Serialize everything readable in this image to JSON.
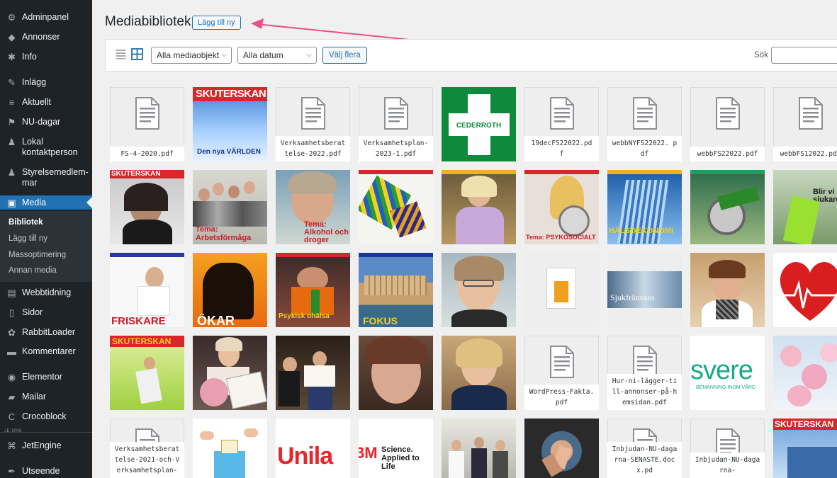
{
  "sidebar": {
    "items": [
      {
        "label": "Adminpanel",
        "icon": "dashboard-icon",
        "glyph": "⚙"
      },
      {
        "label": "Annonser",
        "icon": "pin-icon",
        "glyph": "◆"
      },
      {
        "label": "Info",
        "icon": "gear-icon",
        "glyph": "✱"
      },
      {
        "label": "Inlägg",
        "icon": "pushpin-icon",
        "glyph": "✎"
      },
      {
        "label": "Aktuellt",
        "icon": "menu-icon",
        "glyph": "≡"
      },
      {
        "label": "NU-dagar",
        "icon": "flag-icon",
        "glyph": "⚑"
      },
      {
        "label": "Lokal kontaktperson",
        "icon": "person-icon",
        "glyph": "♟"
      },
      {
        "label": "Styrelsemedlem-mar",
        "icon": "person-icon",
        "glyph": "♟"
      },
      {
        "label": "Media",
        "icon": "media-icon",
        "glyph": "▣"
      },
      {
        "label": "Webbtidning",
        "icon": "table-icon",
        "glyph": "▤"
      },
      {
        "label": "Sidor",
        "icon": "page-icon",
        "glyph": "▯"
      },
      {
        "label": "RabbitLoader",
        "icon": "rabbit-icon",
        "glyph": "✿"
      },
      {
        "label": "Kommentarer",
        "icon": "comment-icon",
        "glyph": "▬"
      },
      {
        "label": "Elementor",
        "icon": "elementor-icon",
        "glyph": "◉"
      },
      {
        "label": "Mailar",
        "icon": "folder-icon",
        "glyph": "▰"
      },
      {
        "label": "Crocoblock",
        "icon": "crocoblock-icon",
        "glyph": "C"
      },
      {
        "label": "JetEngine",
        "icon": "jetengine-icon",
        "glyph": "⌘"
      },
      {
        "label": "Utseende",
        "icon": "brush-icon",
        "glyph": "✒"
      }
    ],
    "submenu": [
      "Bibliotek",
      "Lägg till ny",
      "Massoptimering",
      "Annan media"
    ],
    "jet_divider": "JE·ONS"
  },
  "header": {
    "title": "Mediabibliotek",
    "add_new": "Lägg till ny"
  },
  "toolbar": {
    "filter_type": "Alla mediaobjekt",
    "filter_date": "Alla datum",
    "bulk_select": "Välj flera",
    "search_label": "Sök",
    "search_value": ""
  },
  "colors": {
    "sidebar_bg": "#1d2327",
    "active_bg": "#2271b1",
    "annotation_arrow": "#e8518a"
  },
  "media": [
    {
      "kind": "doc",
      "label": "FS-4-2020.pdf"
    },
    {
      "kind": "img",
      "style": "skuterskan-blue",
      "text": "SKUTERSKAN",
      "text2": "Den nya VÄRLDEN"
    },
    {
      "kind": "doc",
      "label": "Verksamhetsberat telse-2022.pdf"
    },
    {
      "kind": "doc",
      "label": "Verksamhetsplan-2023-1.pdf"
    },
    {
      "kind": "img",
      "style": "cederroth",
      "text": "CEDERROTH"
    },
    {
      "kind": "doc",
      "label": "19decFS22022.pd f"
    },
    {
      "kind": "doc",
      "label": "webbNYFS22022. pdf"
    },
    {
      "kind": "doc",
      "label": "webbFS22022.pdf"
    },
    {
      "kind": "doc",
      "label": "webbFS12022.pdf"
    },
    {
      "kind": "img",
      "style": "cover-portrait-dark",
      "text": "SKUTERSKAN"
    },
    {
      "kind": "img",
      "style": "cover-group",
      "text": "Tema: Arbetsförmåga"
    },
    {
      "kind": "img",
      "style": "cover-smile",
      "text": "Tema: Alkohol och droger"
    },
    {
      "kind": "img",
      "style": "cover-art",
      "text": ""
    },
    {
      "kind": "img",
      "style": "cover-woman-lilac",
      "text": ""
    },
    {
      "kind": "img",
      "style": "cover-clock",
      "text": "Tema: PSYKOSOCIALT"
    },
    {
      "kind": "img",
      "style": "cover-building",
      "text": "HÄLSOEKONOMI"
    },
    {
      "kind": "img",
      "style": "cover-grinder",
      "text": ""
    },
    {
      "kind": "img",
      "style": "cover-worker",
      "text": "Blir vi sjukare?"
    },
    {
      "kind": "img",
      "style": "cover-white-stretch",
      "text": "FRISKARE"
    },
    {
      "kind": "img",
      "style": "cover-orange",
      "text": "ÖKAR"
    },
    {
      "kind": "img",
      "style": "cover-bottle",
      "text": "Psykisk ohälsa"
    },
    {
      "kind": "img",
      "style": "cover-castle",
      "text": "FOKUS"
    },
    {
      "kind": "img",
      "style": "photo-woman-glasses",
      "text": ""
    },
    {
      "kind": "img",
      "style": "thumb-small-doc",
      "text": ""
    },
    {
      "kind": "img",
      "style": "banner-office",
      "text": "Sjukfrånvaro"
    },
    {
      "kind": "img",
      "style": "photo-woman-scarf",
      "text": ""
    },
    {
      "kind": "img",
      "style": "heart-ecg",
      "text": ""
    },
    {
      "kind": "img",
      "style": "cover-green-yoga",
      "text": "SKUTERSKAN"
    },
    {
      "kind": "img",
      "style": "photo-award",
      "text": ""
    },
    {
      "kind": "img",
      "style": "photo-diploma",
      "text": ""
    },
    {
      "kind": "img",
      "style": "photo-woman-closeup",
      "text": ""
    },
    {
      "kind": "img",
      "style": "photo-woman-blond",
      "text": ""
    },
    {
      "kind": "doc",
      "label": "WordPress-Fakta.pdf"
    },
    {
      "kind": "doc",
      "label": "Hur-ni-lägger-till-annonser-på-hemsidan.pdf"
    },
    {
      "kind": "img",
      "style": "svere-logo",
      "text": "svere",
      "text2": "BEMANNING INOM VÅRD"
    },
    {
      "kind": "img",
      "style": "cherry-blossom",
      "text": ""
    },
    {
      "kind": "doc",
      "label": "Verksamhetsberat telse-2021-och-Verksamhetsplan-"
    },
    {
      "kind": "img",
      "style": "illustration-vote",
      "text": ""
    },
    {
      "kind": "img",
      "style": "unilabs-logo",
      "text": "Unila"
    },
    {
      "kind": "img",
      "style": "3m-logo",
      "text": "3M",
      "text2": "Science. Applied to Life"
    },
    {
      "kind": "img",
      "style": "photo-meeting",
      "text": ""
    },
    {
      "kind": "img",
      "style": "photo-hands",
      "text": ""
    },
    {
      "kind": "doc",
      "label": "Inbjudan-NU-dagarna-SENASTE.docx.pd"
    },
    {
      "kind": "doc",
      "label": "Inbjudan-NU-dagarna-"
    },
    {
      "kind": "img",
      "style": "cover-skuterskan-last",
      "text": "SKUTERSKAN"
    }
  ]
}
